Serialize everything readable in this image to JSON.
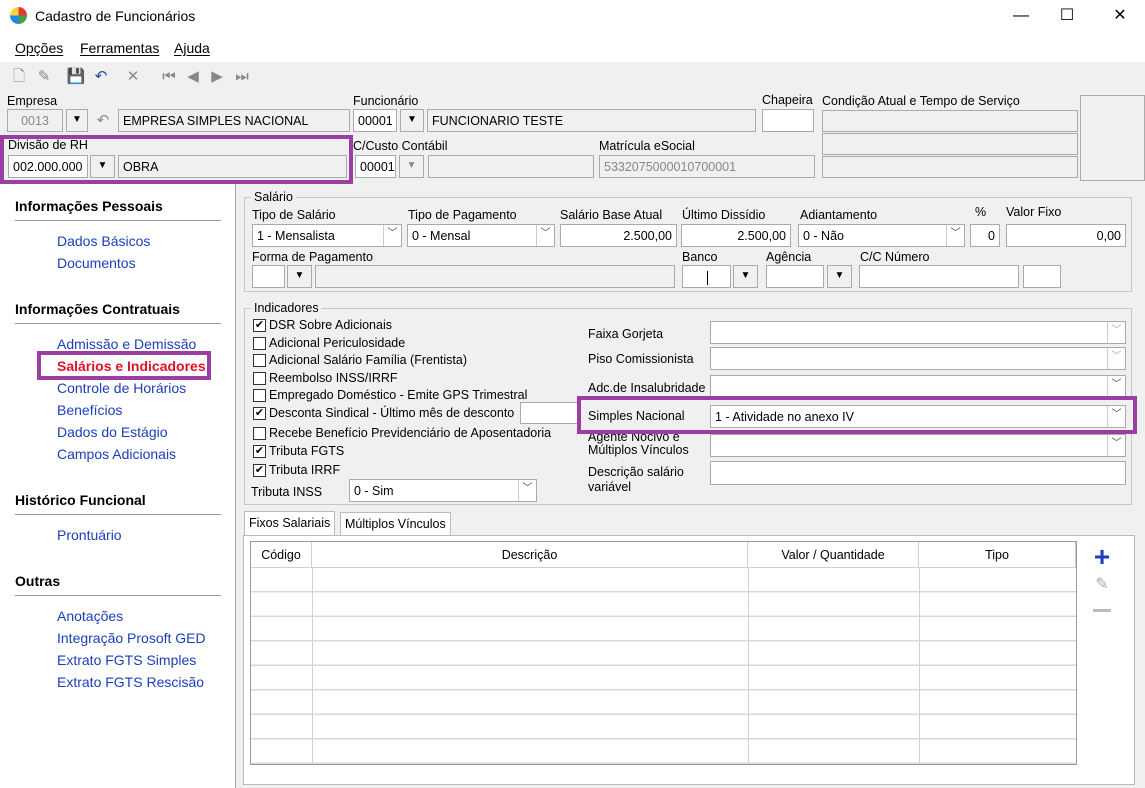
{
  "window": {
    "title": "Cadastro de Funcionários",
    "minimize": "—",
    "maximize": "☐",
    "close": "✕"
  },
  "menu": [
    "Opções",
    "Ferramentas",
    "Ajuda"
  ],
  "toolbar_icons": [
    "new-document-icon",
    "edit-icon",
    "save-icon",
    "undo-icon",
    "delete-icon",
    "first-record-icon",
    "previous-record-icon",
    "next-record-icon",
    "last-record-icon"
  ],
  "header": {
    "empresa_label": "Empresa",
    "empresa_code": "0013",
    "empresa_name": "EMPRESA SIMPLES NACIONAL",
    "funcionario_label": "Funcionário",
    "funcionario_code": "00001",
    "funcionario_name": "FUNCIONARIO TESTE",
    "chapeira_label": "Chapeira",
    "chapeira_value": "",
    "condicao_label": "Condição Atual e Tempo de Serviço",
    "divisao_label": "Divisão de RH",
    "divisao_code": "002.000.000",
    "divisao_name": "OBRA",
    "ccusto_label": "C/Custo Contábil",
    "ccusto_code": "00001",
    "ccusto_name": "",
    "matricula_label": "Matrícula eSocial",
    "matricula_value": "533207500001070000​1"
  },
  "nav": {
    "sections": [
      {
        "title": "Informações Pessoais",
        "items": [
          "Dados Básicos",
          "Documentos"
        ]
      },
      {
        "title": "Informações Contratuais",
        "items": [
          "Admissão e Demissão",
          "Salários e Indicadores",
          "Controle de Horários",
          "Benefícios",
          "Dados do Estágio",
          "Campos Adicionais"
        ]
      },
      {
        "title": "Histórico Funcional",
        "items": [
          "Prontuário"
        ]
      },
      {
        "title": "Outras",
        "items": [
          "Anotações",
          "Integração Prosoft GED",
          "Extrato FGTS Simples",
          "Extrato FGTS Rescisão"
        ]
      }
    ],
    "active": "Salários e Indicadores"
  },
  "salario": {
    "group_label": "Salário",
    "tipo_salario_label": "Tipo de Salário",
    "tipo_salario_value": "1 - Mensalista",
    "tipo_pagamento_label": "Tipo de Pagamento",
    "tipo_pagamento_value": "0 - Mensal",
    "salario_base_label": "Salário Base Atual",
    "salario_base_value": "2.500,00",
    "ultimo_dissidio_label": "Último Dissídio",
    "ultimo_dissidio_value": "2.500,00",
    "adiantamento_label": "Adiantamento",
    "adiantamento_value": "0 - Não",
    "percent_label": "%",
    "percent_value": "0",
    "valor_fixo_label": "Valor Fixo",
    "valor_fixo_value": "0,00",
    "forma_pagamento_label": "Forma de Pagamento",
    "banco_label": "Banco",
    "agencia_label": "Agência",
    "cc_numero_label": "C/C Número"
  },
  "indicadores": {
    "group_label": "Indicadores",
    "checks": [
      {
        "label": "DSR Sobre Adicionais",
        "checked": true
      },
      {
        "label": "Adicional Periculosidade",
        "checked": false
      },
      {
        "label": "Adicional Salário Família (Frentista)",
        "checked": false
      },
      {
        "label": "Reembolso INSS/IRRF",
        "checked": false
      },
      {
        "label": "Empregado Doméstico - Emite GPS Trimestral",
        "checked": false
      },
      {
        "label": "Desconta Sindical - Último mês de desconto",
        "checked": true
      },
      {
        "label": "Recebe Benefício Previdenciário de Aposentadoria",
        "checked": false
      },
      {
        "label": "Tributa FGTS",
        "checked": true
      },
      {
        "label": "Tributa IRRF",
        "checked": true
      }
    ],
    "tributa_inss_label": "Tributa INSS",
    "tributa_inss_value": "0 - Sim",
    "faixa_gorjeta_label": "Faixa Gorjeta",
    "piso_comissionista_label": "Piso Comissionista",
    "adc_insalubridade_label": "Adc.de Insalubridade",
    "simples_nacional_label": "Simples Nacional",
    "simples_nacional_value": "1 - Atividade no anexo IV",
    "agente_nocivo_label_1": "Agente Nocivo e",
    "agente_nocivo_label_2": "Múltiplos Vínculos",
    "descricao_salario_label_1": "Descrição salário",
    "descricao_salario_label_2": "variável"
  },
  "tabs": [
    "Fixos Salariais",
    "Múltiplos Vínculos"
  ],
  "table": {
    "columns": [
      "Código",
      "Descrição",
      "Valor / Quantidade",
      "Tipo"
    ],
    "row_count": 9
  },
  "side_buttons": [
    "add-icon",
    "edit-pencil-icon",
    "remove-icon"
  ]
}
